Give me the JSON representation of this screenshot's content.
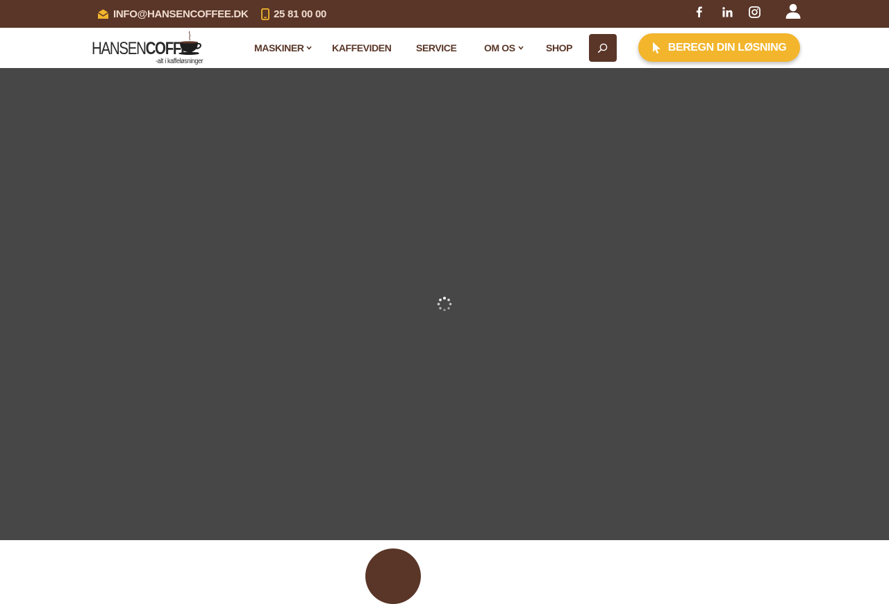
{
  "topbar": {
    "email": "INFO@HANSENCOFFEE.DK",
    "phone": "25 81 00 00",
    "icons": [
      "envelope-icon",
      "phone-icon",
      "facebook-icon",
      "linkedin-icon",
      "instagram-icon",
      "user-icon"
    ]
  },
  "logo": {
    "part1": "HANSEN",
    "part2": "COFFEE",
    "tagline": "-alt i kaffeløsninger"
  },
  "nav": {
    "items": [
      {
        "label": "MASKINER",
        "has_dropdown": true
      },
      {
        "label": "KAFFEVIDEN",
        "has_dropdown": false
      },
      {
        "label": "SERVICE",
        "has_dropdown": false
      },
      {
        "label": "OM OS",
        "has_dropdown": true
      },
      {
        "label": "SHOP",
        "has_dropdown": false
      }
    ],
    "cta_label": "BEREGN DIN LØSNING"
  },
  "colors": {
    "brand_brown": "#5a3628",
    "accent_yellow": "#f2b52c",
    "hero_gray": "#474747"
  }
}
